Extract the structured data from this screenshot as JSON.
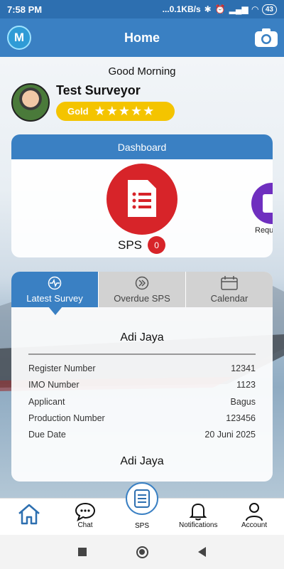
{
  "status": {
    "time": "7:58 PM",
    "speed": "...0.1KB/s",
    "battery": "43"
  },
  "app_bar": {
    "title": "Home",
    "logo_letter": "M"
  },
  "greeting": "Good Morning",
  "user": {
    "name": "Test Surveyor",
    "rank": "Gold",
    "stars": "★★★★★",
    "rating": 5
  },
  "dashboard": {
    "title": "Dashboard",
    "items": [
      {
        "label": "SPS",
        "count": "0",
        "color": "#d72429"
      },
      {
        "label": "Requ",
        "color": "#6f2fbf"
      }
    ]
  },
  "tabs": [
    {
      "label": "Latest Survey",
      "icon": "activity-icon",
      "active": true
    },
    {
      "label": "Overdue SPS",
      "icon": "double-chevron-icon",
      "active": false
    },
    {
      "label": "Calendar",
      "icon": "calendar-icon",
      "active": false
    }
  ],
  "survey": {
    "title": "Adi Jaya",
    "rows": [
      {
        "label": "Register Number",
        "value": "12341"
      },
      {
        "label": "IMO Number",
        "value": "1123"
      },
      {
        "label": "Applicant",
        "value": "Bagus"
      },
      {
        "label": "Production Number",
        "value": "123456"
      },
      {
        "label": "Due Date",
        "value": "20 Juni 2025"
      }
    ],
    "next_title": "Adi Jaya"
  },
  "bottom_nav": [
    {
      "label": "",
      "icon": "home-icon"
    },
    {
      "label": "Chat",
      "icon": "chat-icon"
    },
    {
      "label": "SPS",
      "icon": "document-icon"
    },
    {
      "label": "Notifications",
      "icon": "bell-icon"
    },
    {
      "label": "Account",
      "icon": "person-icon"
    }
  ],
  "colors": {
    "primary": "#3a80c3",
    "accent_red": "#d72429",
    "gold": "#f4c400"
  }
}
